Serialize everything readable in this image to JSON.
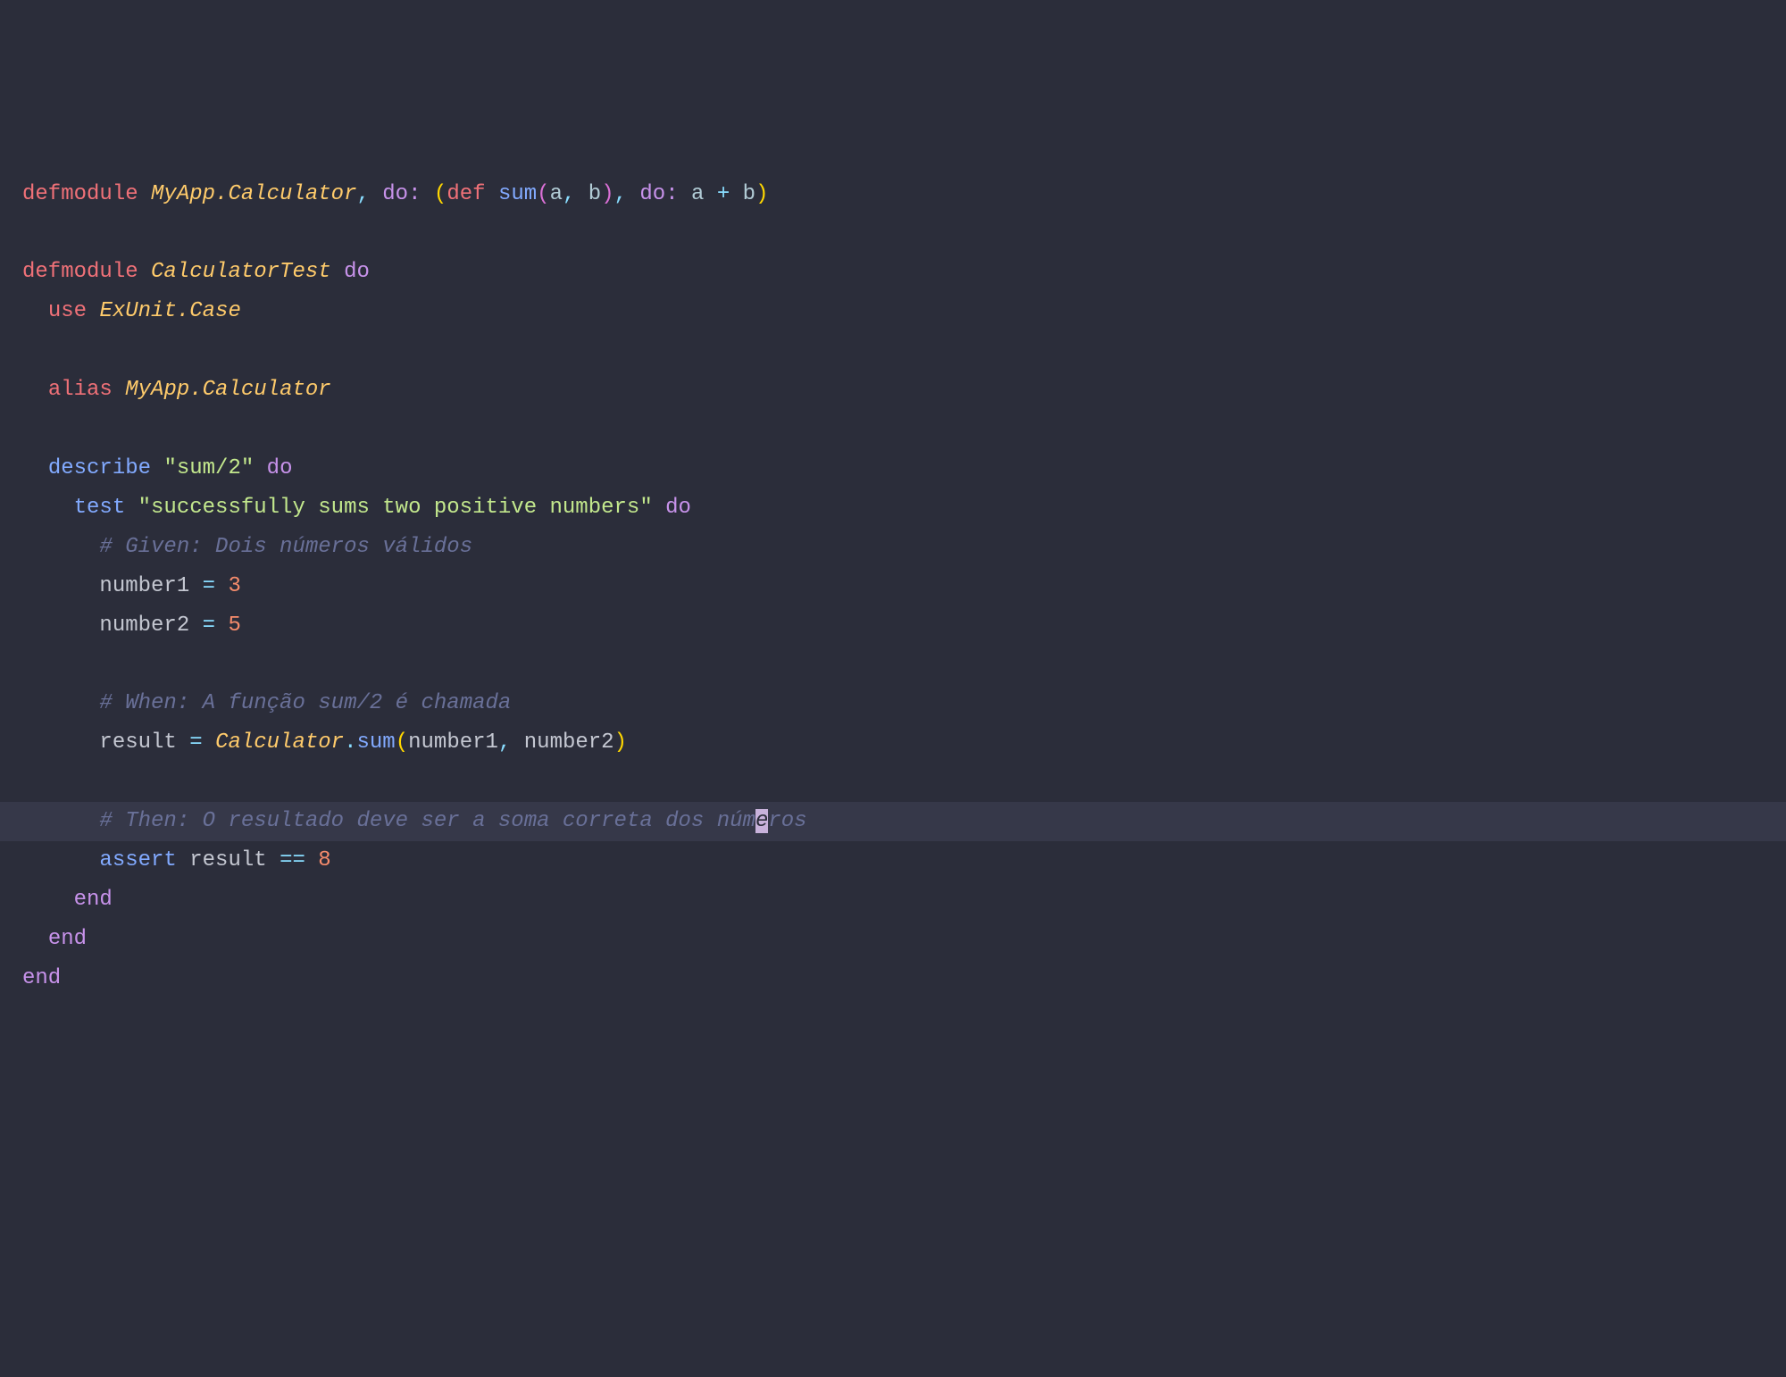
{
  "code": {
    "line1": {
      "defmodule": "defmodule",
      "module1": "MyApp.Calculator",
      "comma": ",",
      "do1": "do:",
      "lparen1": "(",
      "def": "def",
      "sum": "sum",
      "lparen2": "(",
      "a": "a",
      "comma2": ",",
      "b": "b",
      "rparen2": ")",
      "comma3": ",",
      "do2": "do:",
      "a2": "a",
      "plus": "+",
      "b2": "b",
      "rparen1": ")"
    },
    "line3": {
      "defmodule": "defmodule",
      "module": "CalculatorTest",
      "do": "do"
    },
    "line4": {
      "use": "use",
      "module": "ExUnit.Case"
    },
    "line6": {
      "alias": "alias",
      "module": "MyApp.Calculator"
    },
    "line8": {
      "describe": "describe",
      "string": "\"sum/2\"",
      "do": "do"
    },
    "line9": {
      "test": "test",
      "string": "\"successfully sums two positive numbers\"",
      "do": "do"
    },
    "line10": {
      "comment": "# Given: Dois números válidos"
    },
    "line11": {
      "var": "number1",
      "eq": "=",
      "num": "3"
    },
    "line12": {
      "var": "number2",
      "eq": "=",
      "num": "5"
    },
    "line14": {
      "comment": "# When: A função sum/2 é chamada"
    },
    "line15": {
      "var": "result",
      "eq": "=",
      "module": "Calculator",
      "dot": ".",
      "fn": "sum",
      "lparen": "(",
      "arg1": "number1",
      "comma": ",",
      "arg2": "number2",
      "rparen": ")"
    },
    "line17": {
      "comment_pre": "# Then: O resultado deve ser a soma correta dos núm",
      "cursor_char": "e",
      "comment_post": "ros"
    },
    "line18": {
      "assert": "assert",
      "var": "result",
      "eq": "==",
      "num": "8"
    },
    "line19": {
      "end": "end"
    },
    "line20": {
      "end": "end"
    },
    "line21": {
      "end": "end"
    }
  }
}
